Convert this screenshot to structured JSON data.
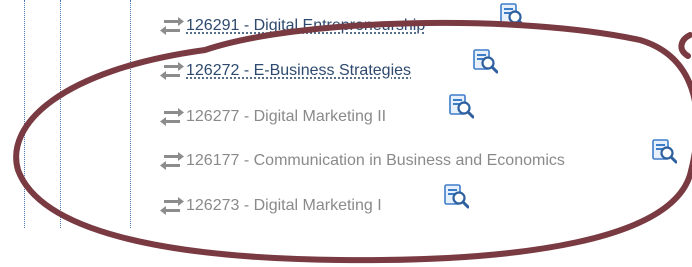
{
  "icons": {
    "swap": "swap-arrows-icon",
    "lookup": "magnifier-document-icon"
  },
  "colors": {
    "link_text": "#2d4a6e",
    "plain_text": "#8a8a8a",
    "annotation": "#7a3a42",
    "guides": "#4a78b0",
    "icon_blue": "#3d7cc9"
  },
  "courses": [
    {
      "label": "126291 - Digital Entrepreneurship",
      "linked": true
    },
    {
      "label": "126272 - E-Business Strategies",
      "linked": true
    },
    {
      "label": "126277 - Digital Marketing II",
      "linked": false
    },
    {
      "label": "126177 - Communication in Business and Economics",
      "linked": false
    },
    {
      "label": "126273 - Digital Marketing I",
      "linked": false
    }
  ]
}
